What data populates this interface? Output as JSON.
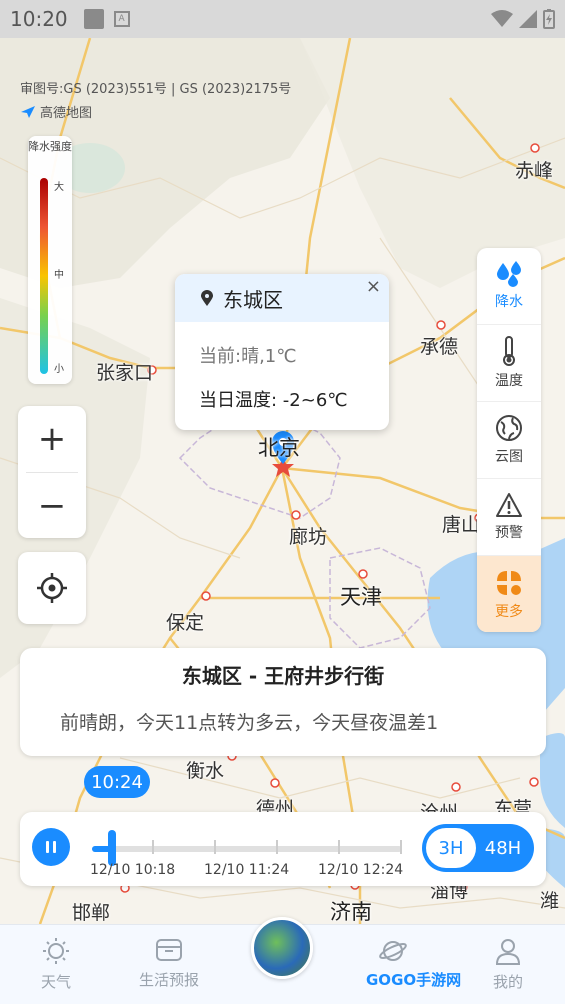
{
  "status_bar": {
    "time": "10:20"
  },
  "map": {
    "copyright": "审图号:GS (2023)551号 | GS (2023)2175号",
    "provider": "高德地图",
    "cities": [
      "赤峰",
      "承德",
      "张家口",
      "北京",
      "廊坊",
      "唐山",
      "天津",
      "保定",
      "衡水",
      "德州",
      "沧州",
      "东营",
      "邯郸",
      "济南",
      "淄博",
      "潍"
    ]
  },
  "legend": {
    "title": "降水强度",
    "levels": [
      "大",
      "中",
      "小"
    ]
  },
  "zoom": {
    "in": "+",
    "out": "−"
  },
  "side_panel": {
    "items": [
      {
        "label": "降水",
        "icon": "rain-drops-icon",
        "active": true
      },
      {
        "label": "温度",
        "icon": "thermometer-icon",
        "active": false
      },
      {
        "label": "云图",
        "icon": "globe-icon",
        "active": false
      },
      {
        "label": "预警",
        "icon": "warning-icon",
        "active": false
      },
      {
        "label": "更多",
        "icon": "more-grid-icon",
        "active": false
      }
    ]
  },
  "popup": {
    "district": "东城区",
    "current": "当前:晴,1℃",
    "temp_range": "当日温度: -2~6℃",
    "close": "×"
  },
  "location_card": {
    "title": "东城区 - 王府井步行街",
    "description": "前晴朗，今天11点转为多云，今天昼夜温差1"
  },
  "timeline": {
    "current_time": "10:24",
    "labels": [
      "12/10 10:18",
      "12/10 11:24",
      "12/10 12:24"
    ],
    "progress": 0.05,
    "range_options": [
      "3H",
      "48H"
    ],
    "selected_range": "3H"
  },
  "bottom_nav": {
    "items": [
      "天气",
      "生活预报",
      "",
      "我的"
    ],
    "watermark": "GOGO手游网"
  },
  "colors": {
    "accent": "#1a8cff",
    "more_bg": "#fde7cf",
    "more_fg": "#f08a17"
  }
}
